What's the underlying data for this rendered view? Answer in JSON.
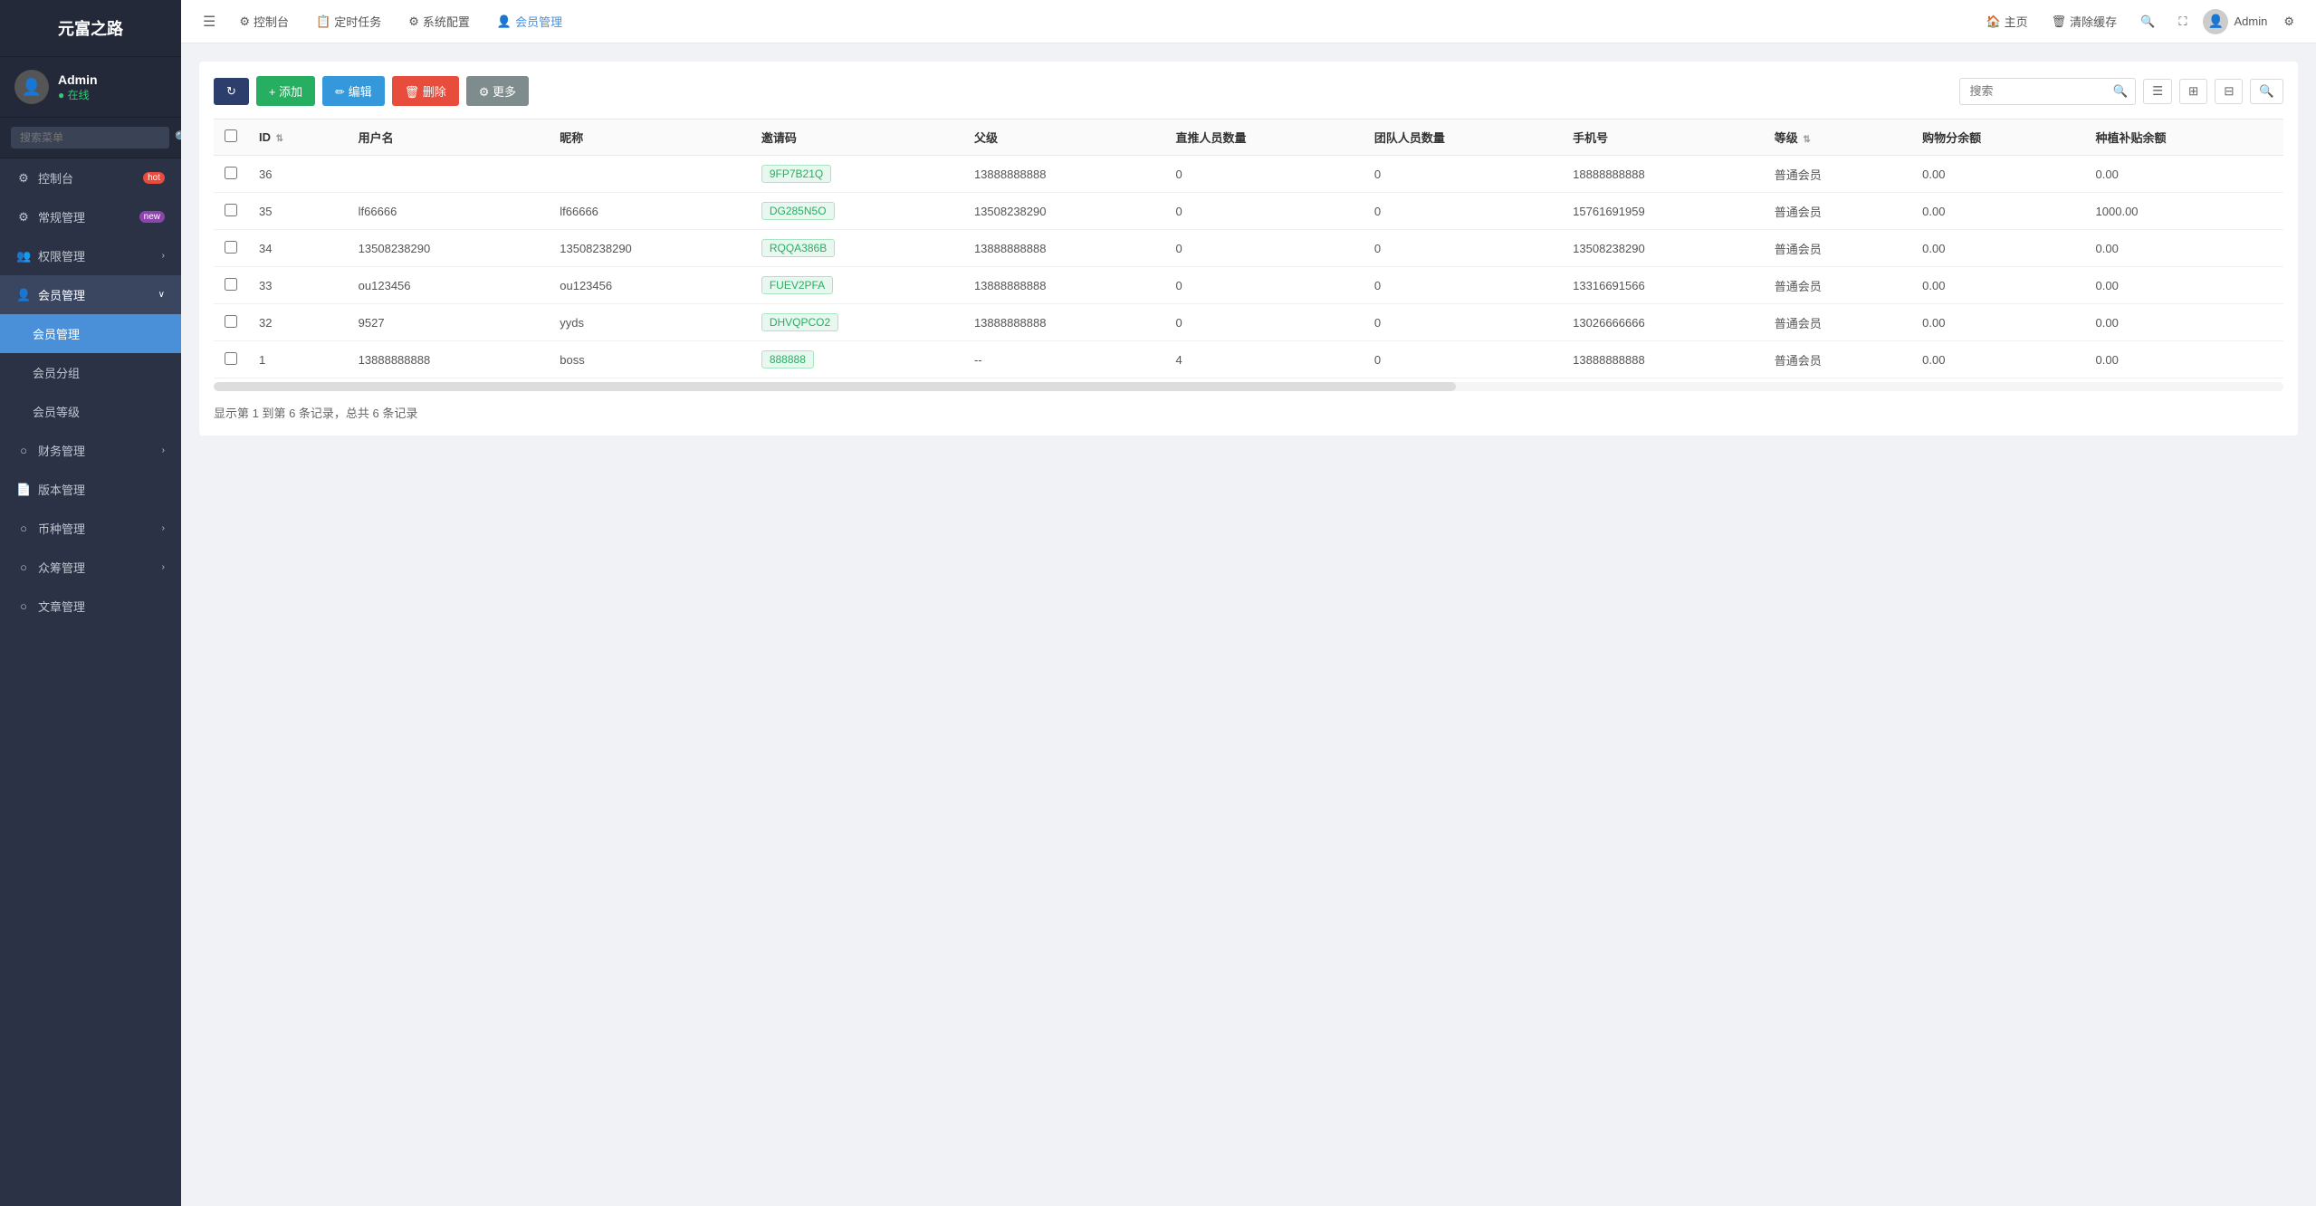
{
  "app": {
    "logo": "元富之路",
    "user": {
      "name": "Admin",
      "status": "在线",
      "avatar": "👤"
    },
    "search_placeholder": "搜索菜单"
  },
  "sidebar": {
    "items": [
      {
        "id": "dashboard",
        "label": "控制台",
        "icon": "⚙",
        "badge": "hot",
        "badge_type": "red"
      },
      {
        "id": "general",
        "label": "常规管理",
        "icon": "⚙",
        "badge": "new",
        "badge_type": "new"
      },
      {
        "id": "permission",
        "label": "权限管理",
        "icon": "👥",
        "has_chevron": true
      },
      {
        "id": "member",
        "label": "会员管理",
        "icon": "👤",
        "expanded": true,
        "active_parent": true
      },
      {
        "id": "member-mgmt",
        "label": "会员管理",
        "icon": "",
        "active": true,
        "sub": true
      },
      {
        "id": "member-group",
        "label": "会员分组",
        "icon": "",
        "sub": true
      },
      {
        "id": "member-level",
        "label": "会员等级",
        "icon": "",
        "sub": true
      },
      {
        "id": "finance",
        "label": "财务管理",
        "icon": "○",
        "has_chevron": true
      },
      {
        "id": "version",
        "label": "版本管理",
        "icon": "📄"
      },
      {
        "id": "currency",
        "label": "币种管理",
        "icon": "○",
        "has_chevron": true
      },
      {
        "id": "crowdfund",
        "label": "众筹管理",
        "icon": "○",
        "has_chevron": true
      },
      {
        "id": "article",
        "label": "文章管理",
        "icon": "○"
      }
    ]
  },
  "topnav": {
    "menu_icon": "☰",
    "items": [
      {
        "id": "dashboard",
        "label": "控制台",
        "icon": "⚙"
      },
      {
        "id": "schedule",
        "label": "定时任务",
        "icon": "📋"
      },
      {
        "id": "sysconfig",
        "label": "系统配置",
        "icon": "⚙"
      },
      {
        "id": "member",
        "label": "会员管理",
        "icon": "👤",
        "active": true
      }
    ],
    "right": [
      {
        "id": "home",
        "label": "主页",
        "icon": "🏠"
      },
      {
        "id": "clear-cache",
        "label": "清除缓存",
        "icon": "🗑"
      },
      {
        "id": "unknown1",
        "label": "",
        "icon": "🔍"
      },
      {
        "id": "fullscreen",
        "label": "",
        "icon": "✕"
      }
    ],
    "admin_label": "Admin",
    "settings_icon": "⚙"
  },
  "toolbar": {
    "refresh_label": "↻",
    "add_label": "+ 添加",
    "edit_label": "✏ 编辑",
    "delete_label": "🗑 删除",
    "more_label": "⚙ 更多",
    "search_placeholder": "搜索"
  },
  "table": {
    "columns": [
      {
        "id": "checkbox",
        "label": ""
      },
      {
        "id": "id",
        "label": "ID",
        "sortable": true
      },
      {
        "id": "username",
        "label": "用户名"
      },
      {
        "id": "nickname",
        "label": "昵称"
      },
      {
        "id": "invite_code",
        "label": "邀请码"
      },
      {
        "id": "parent",
        "label": "父级"
      },
      {
        "id": "direct_count",
        "label": "直推人员数量"
      },
      {
        "id": "team_count",
        "label": "团队人员数量"
      },
      {
        "id": "phone",
        "label": "手机号"
      },
      {
        "id": "level",
        "label": "等级",
        "sortable": true
      },
      {
        "id": "shopping_balance",
        "label": "购物分余额"
      },
      {
        "id": "subsidy_balance",
        "label": "种植补贴余额"
      }
    ],
    "rows": [
      {
        "id": "36",
        "username": "",
        "nickname": "",
        "invite_code": "9FP7B21Q",
        "invite_code_color": "green",
        "parent": "13888888888",
        "direct_count": "0",
        "team_count": "0",
        "phone": "18888888888",
        "level": "普通会员",
        "shopping_balance": "0.00",
        "subsidy_balance": "0.00"
      },
      {
        "id": "35",
        "username": "lf66666",
        "nickname": "lf66666",
        "invite_code": "DG285N5O",
        "invite_code_color": "green",
        "parent": "13508238290",
        "direct_count": "0",
        "team_count": "0",
        "phone": "15761691959",
        "level": "普通会员",
        "shopping_balance": "0.00",
        "subsidy_balance": "1000.00"
      },
      {
        "id": "34",
        "username": "13508238290",
        "nickname": "13508238290",
        "invite_code": "RQQA386B",
        "invite_code_color": "green",
        "parent": "13888888888",
        "direct_count": "0",
        "team_count": "0",
        "phone": "13508238290",
        "level": "普通会员",
        "shopping_balance": "0.00",
        "subsidy_balance": "0.00"
      },
      {
        "id": "33",
        "username": "ou123456",
        "nickname": "ou123456",
        "invite_code": "FUEV2PFA",
        "invite_code_color": "green",
        "parent": "13888888888",
        "direct_count": "0",
        "team_count": "0",
        "phone": "13316691566",
        "level": "普通会员",
        "shopping_balance": "0.00",
        "subsidy_balance": "0.00"
      },
      {
        "id": "32",
        "username": "9527",
        "nickname": "yyds",
        "invite_code": "DHVQPCO2",
        "invite_code_color": "green",
        "parent": "13888888888",
        "direct_count": "0",
        "team_count": "0",
        "phone": "13026666666",
        "level": "普通会员",
        "shopping_balance": "0.00",
        "subsidy_balance": "0.00"
      },
      {
        "id": "1",
        "username": "13888888888",
        "nickname": "boss",
        "invite_code": "888888",
        "invite_code_color": "green",
        "parent": "--",
        "direct_count": "4",
        "team_count": "0",
        "phone": "13888888888",
        "level": "普通会员",
        "shopping_balance": "0.00",
        "subsidy_balance": "0.00"
      }
    ],
    "pagination_text": "显示第 1 到第 6 条记录，总共 6 条记录"
  }
}
